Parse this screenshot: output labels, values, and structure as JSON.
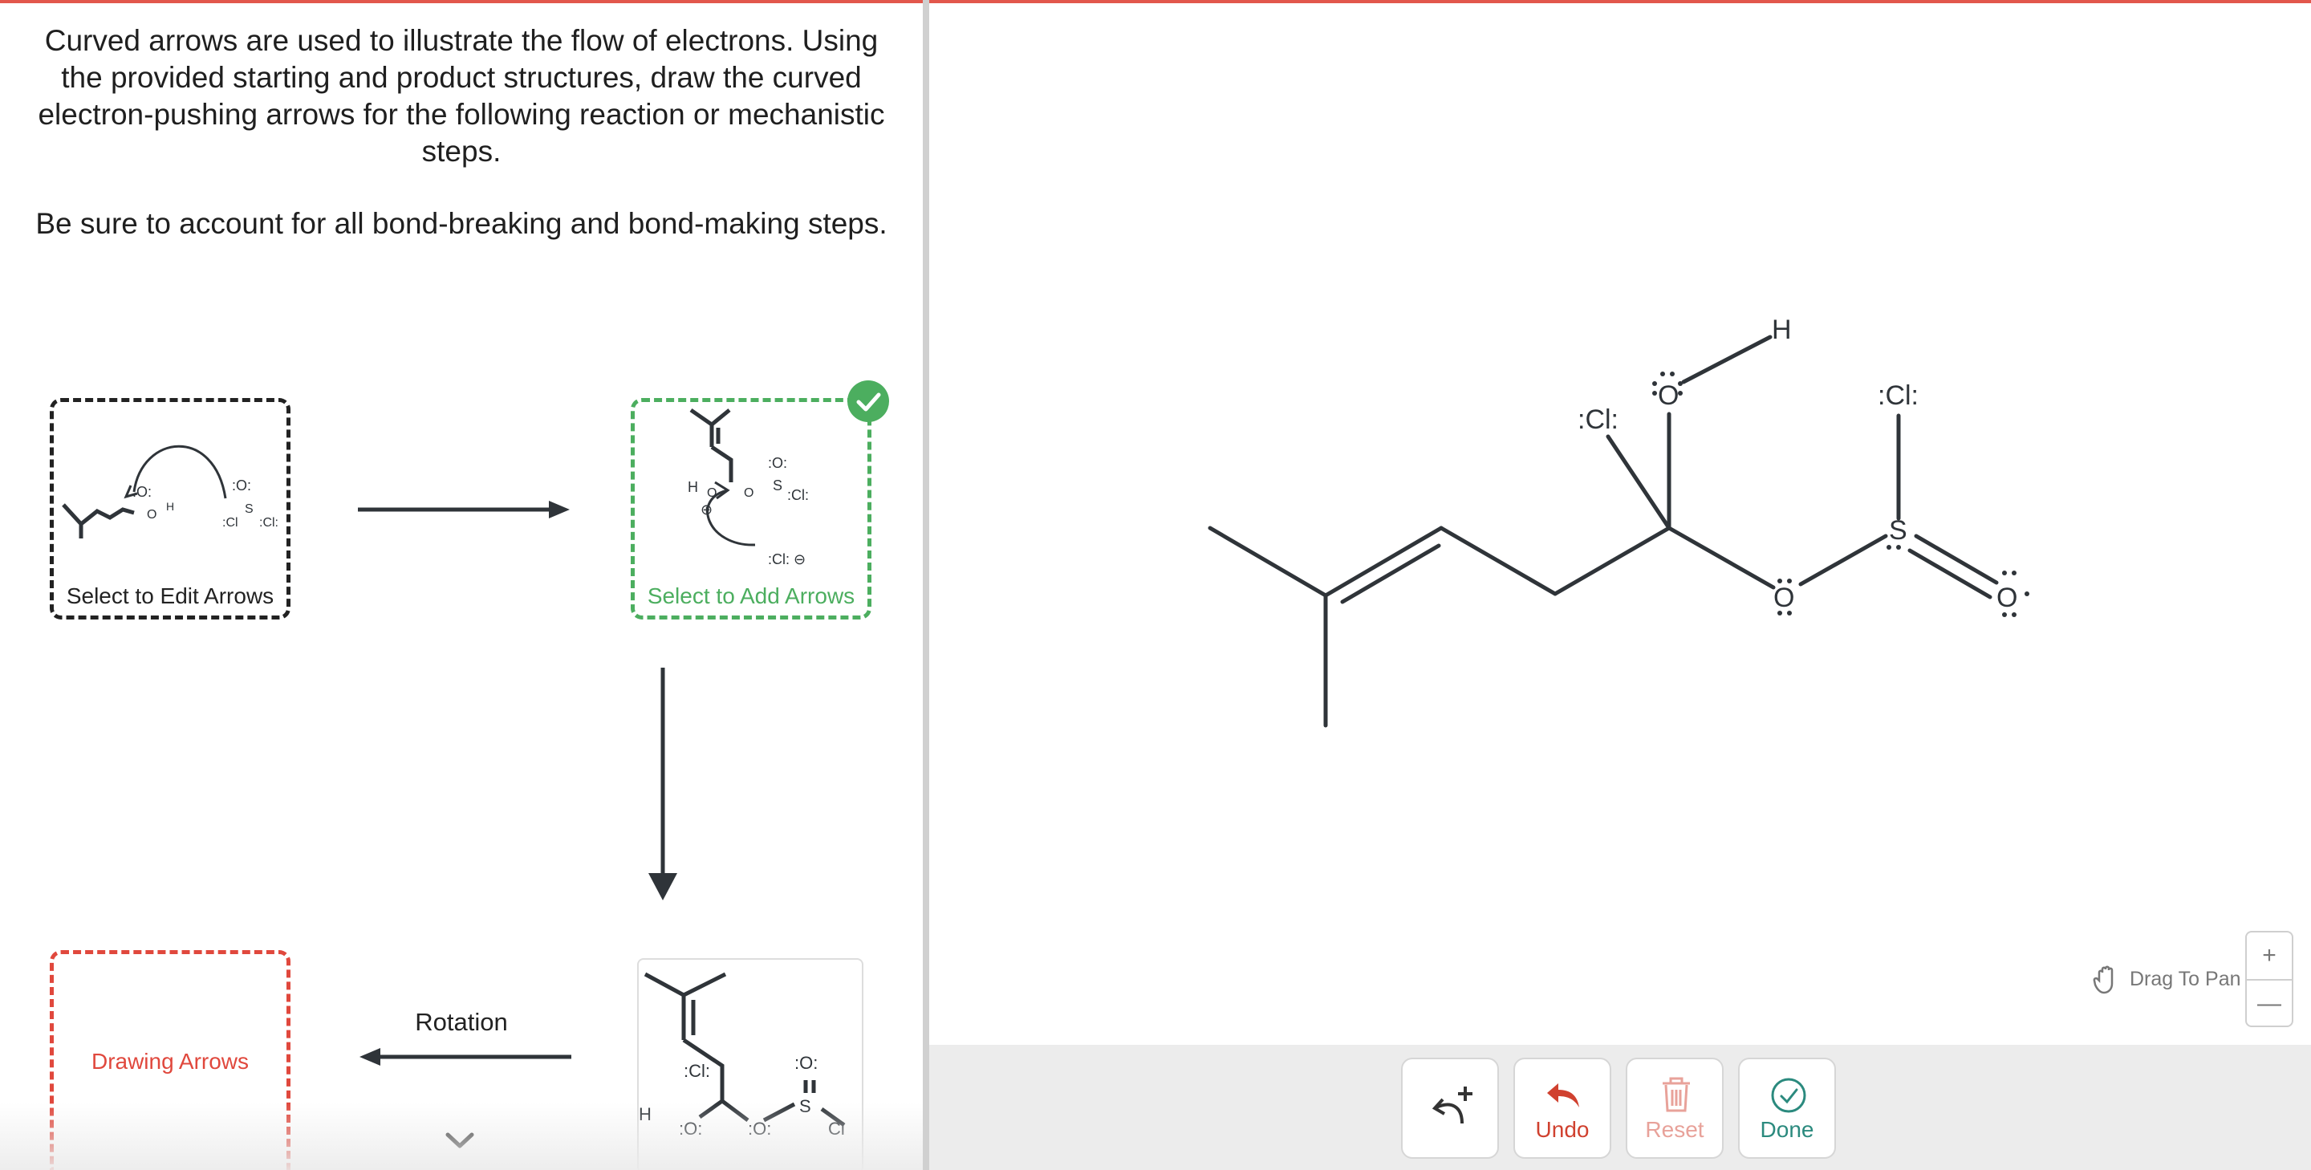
{
  "instructions": {
    "paragraph1": "Curved arrows are used to illustrate the flow of electrons. Using the provided starting and product structures, draw the curved electron-pushing arrows for the following reaction or mechanistic steps.",
    "paragraph2": "Be sure to account for all bond-breaking and bond-making steps."
  },
  "panels": {
    "edit_caption": "Select to Edit Arrows",
    "add_caption": "Select to Add Arrows",
    "drawing_caption": "Drawing Arrows",
    "rotation_label": "Rotation"
  },
  "toolbar": {
    "undo_label": "Undo",
    "reset_label": "Reset",
    "done_label": "Done"
  },
  "canvas": {
    "drag_label": "Drag To Pan",
    "zoom_in": "+",
    "zoom_out": "—"
  },
  "molecule_labels": {
    "cl_left": ":Cl:",
    "o_hydroxyl": "O",
    "h_hydroxyl": "H",
    "o_ester": "O",
    "s_atom": "S",
    "cl_on_s": ":Cl:",
    "o_sulfinyl": "O"
  },
  "colors": {
    "accent_red": "#e2574c",
    "success_green": "#4cae5f",
    "undo_red": "#d0412f",
    "reset_pink": "#e8a29a",
    "done_teal": "#2b8a7e"
  }
}
